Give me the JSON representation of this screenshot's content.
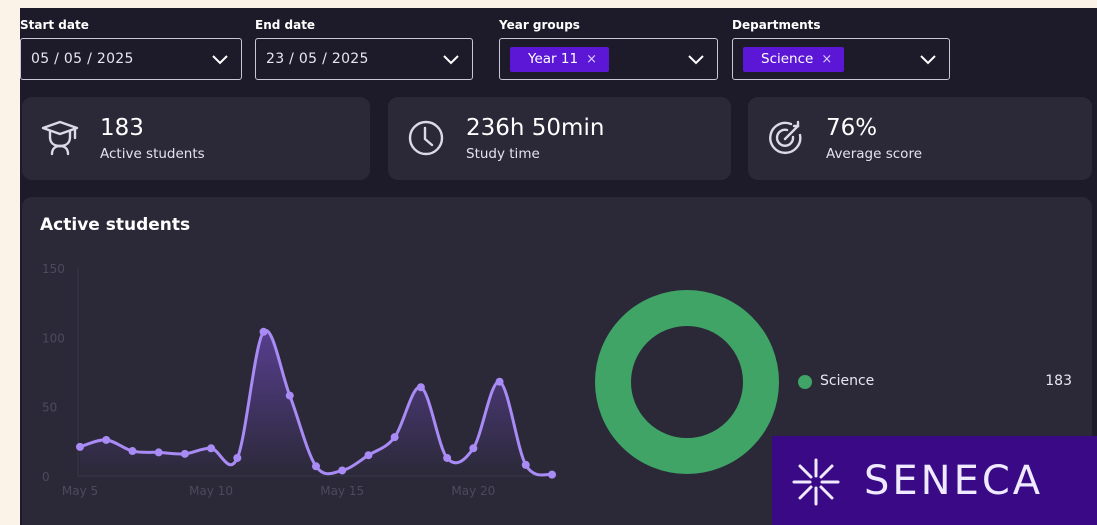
{
  "filters": {
    "start": {
      "label": "Start date",
      "value": "05 / 05 / 2025"
    },
    "end": {
      "label": "End date",
      "value": "23 / 05 / 2025"
    },
    "year": {
      "label": "Year groups",
      "chip": "Year 11"
    },
    "dept": {
      "label": "Departments",
      "chip": "Science"
    },
    "chip_close": "×"
  },
  "stats": [
    {
      "value": "183",
      "label": "Active students",
      "icon": "graduation-cap-icon"
    },
    {
      "value": "236h 50min",
      "label": "Study time",
      "icon": "clock-icon"
    },
    {
      "value": "76%",
      "label": "Average score",
      "icon": "target-icon"
    }
  ],
  "panel": {
    "title": "Active students",
    "legend": [
      {
        "label": "Science",
        "value": "183",
        "color": "#3fa466"
      }
    ]
  },
  "chart_data": [
    {
      "type": "line",
      "title": "Active students",
      "ylim": [
        0,
        150
      ],
      "yticks": [
        "150",
        "100",
        "50",
        "0"
      ],
      "ytick_values": [
        150,
        100,
        50,
        0
      ],
      "xticks": [
        "May 5",
        "May 10",
        "May 15",
        "May 20"
      ],
      "xtick_values": [
        5,
        10,
        15,
        20
      ],
      "x": [
        5,
        6,
        7,
        8,
        9,
        10,
        11,
        12,
        13,
        14,
        15,
        16,
        17,
        18,
        19,
        20,
        21,
        22,
        23
      ],
      "series": [
        {
          "values": [
            21,
            26,
            18,
            17,
            16,
            20,
            13,
            104,
            58,
            7,
            4,
            15,
            28,
            64,
            13,
            20,
            68,
            8,
            1
          ],
          "color": "#a98bf5"
        }
      ]
    },
    {
      "type": "pie",
      "donut": true,
      "categories": [
        "Science"
      ],
      "values": [
        183
      ],
      "colors": [
        "#3fa466"
      ]
    }
  ],
  "logo": {
    "text": "SENECA"
  }
}
